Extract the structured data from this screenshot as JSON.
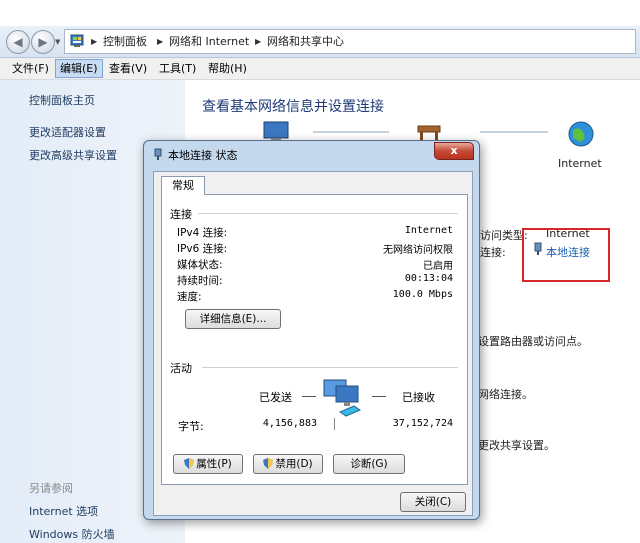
{
  "breadcrumb": [
    "控制面板",
    "网络和 Internet",
    "网络和共享中心"
  ],
  "menu": [
    {
      "label": "文件(F)"
    },
    {
      "label": "编辑(E)"
    },
    {
      "label": "查看(V)"
    },
    {
      "label": "工具(T)"
    },
    {
      "label": "帮助(H)"
    }
  ],
  "sidebar": {
    "home": "控制面板主页",
    "links": [
      "更改适配器设置",
      "更改高级共享设置"
    ],
    "see_also": "另请参阅",
    "see_also_links": [
      "Internet 选项",
      "Windows 防火墙"
    ]
  },
  "main": {
    "title": "查看基本网络信息并设置连接",
    "internet_label": "Internet",
    "access_type_label": "访问类型:",
    "access_type_value": "Internet",
    "connection_label": "连接:",
    "connection_value": "本地连接",
    "text_router": "设置路由器或访问点。",
    "text_network": "网络连接。",
    "text_sharing": "更改共享设置。"
  },
  "dialog": {
    "title": "本地连接 状态",
    "close": "x",
    "tab": "常规",
    "connection_group": "连接",
    "rows": [
      {
        "label": "IPv4 连接:",
        "value": "Internet"
      },
      {
        "label": "IPv6 连接:",
        "value": "无网络访问权限"
      },
      {
        "label": "媒体状态:",
        "value": "已启用"
      },
      {
        "label": "持续时间:",
        "value": "00:13:04"
      },
      {
        "label": "速度:",
        "value": "100.0 Mbps"
      }
    ],
    "details_button": "详细信息(E)...",
    "activity_group": "活动",
    "sent_label": "已发送",
    "received_label": "已接收",
    "bytes_label": "字节:",
    "bytes_sent": "4,156,883",
    "bytes_received": "37,152,724",
    "properties_button": "属性(P)",
    "disable_button": "禁用(D)",
    "diagnose_button": "诊断(G)",
    "close_button": "关闭(C)"
  },
  "colors": {
    "link": "#1e3a5f",
    "title_blue": "#1e3a7a",
    "red_highlight": "#d9262b"
  }
}
